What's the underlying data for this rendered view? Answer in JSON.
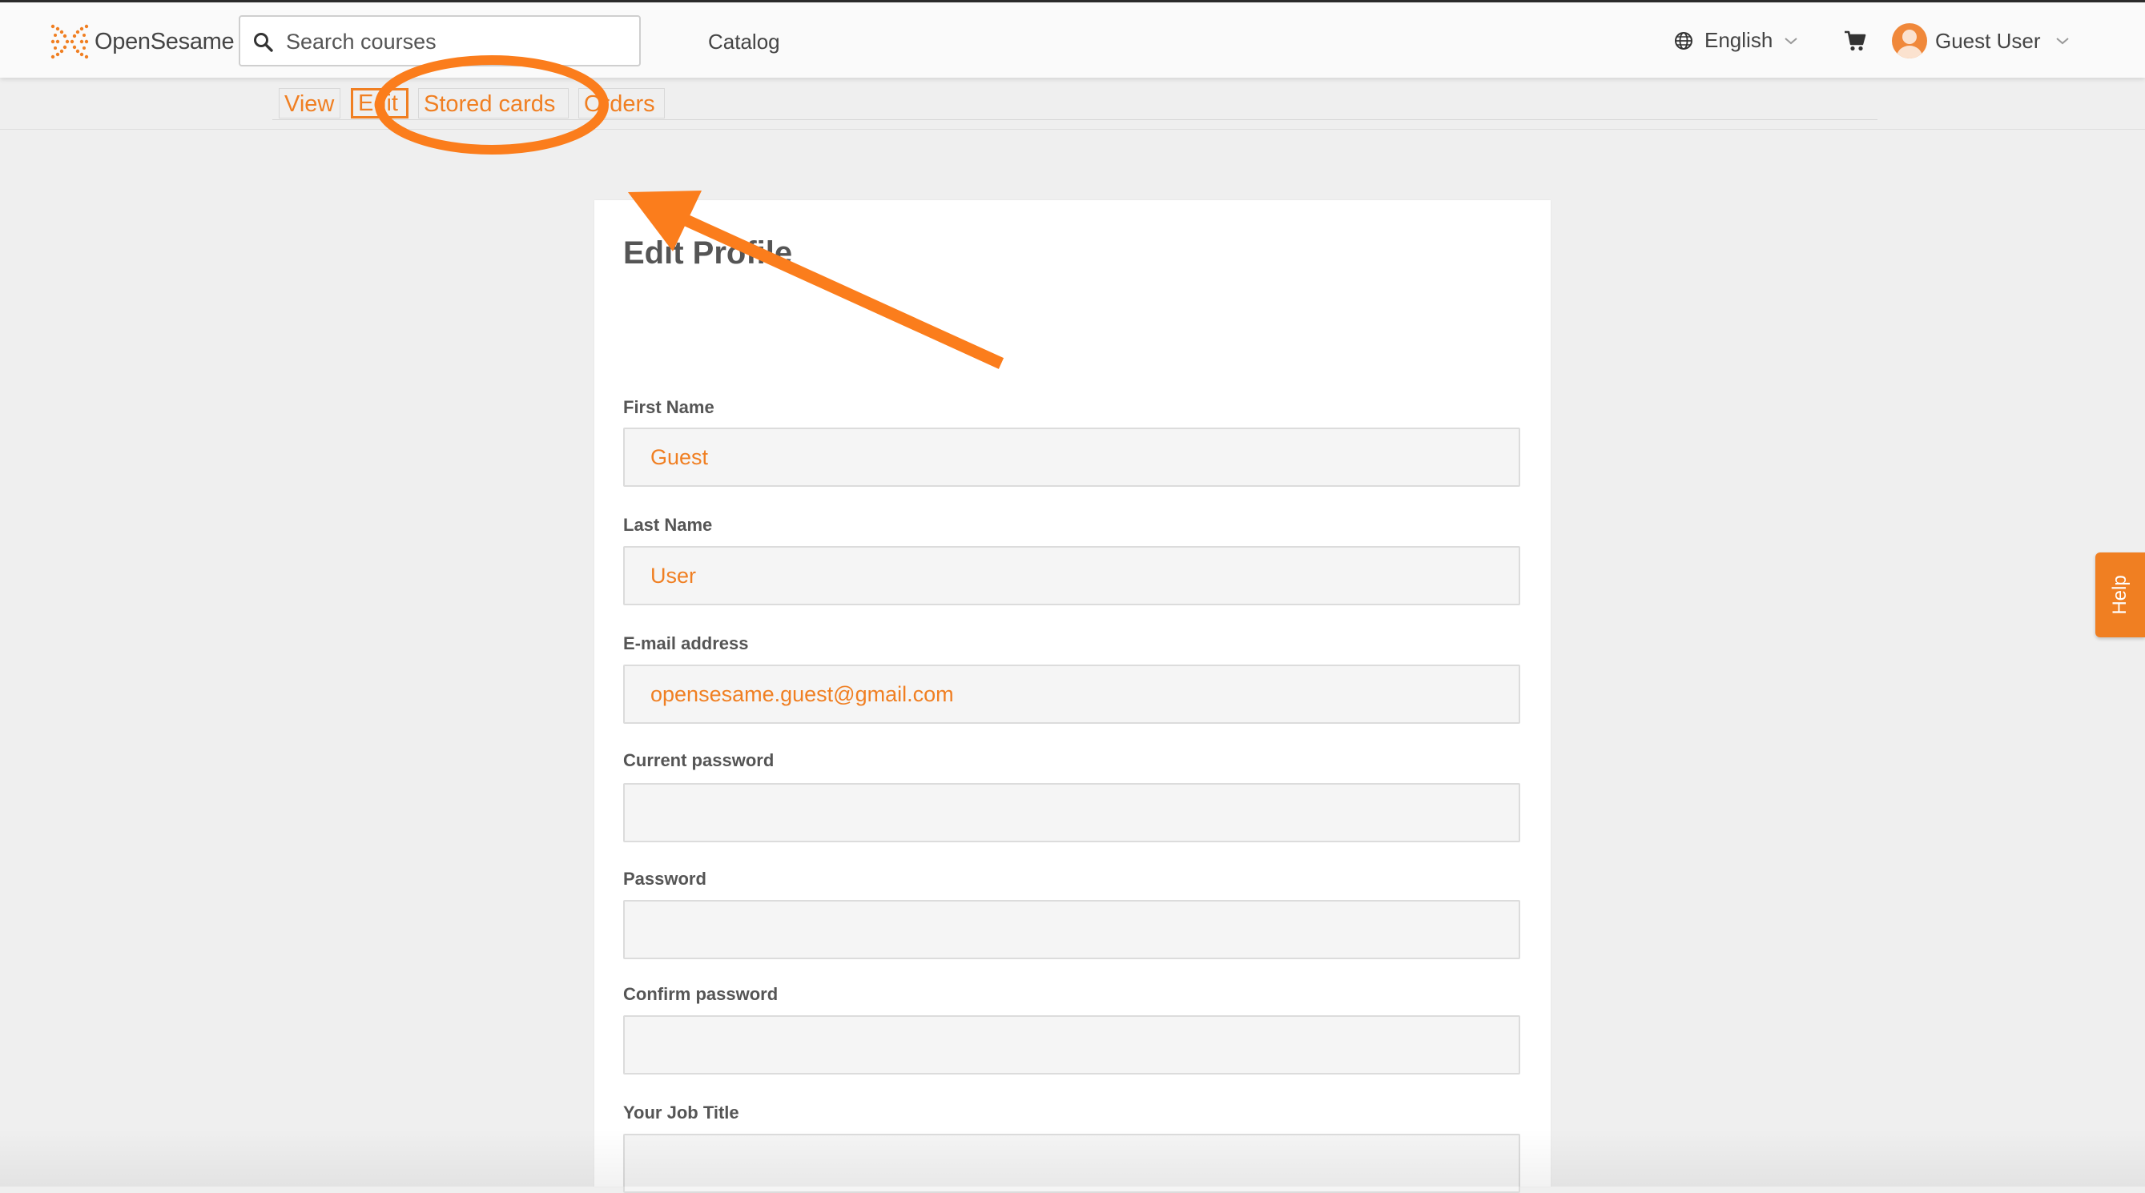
{
  "header": {
    "logo_text": "OpenSesame",
    "search_placeholder": "Search courses",
    "nav_catalog": "Catalog",
    "language": "English",
    "user_name": "Guest User"
  },
  "tabs": [
    {
      "label": "View",
      "active": false
    },
    {
      "label": "Edit",
      "active": true
    },
    {
      "label": "Stored cards",
      "active": false
    },
    {
      "label": "Orders",
      "active": false
    }
  ],
  "form": {
    "title": "Edit Profile",
    "fields": [
      {
        "label": "First Name",
        "value": ""
      },
      {
        "label": "Last Name",
        "value": ""
      },
      {
        "label": "E-mail address",
        "value": ""
      },
      {
        "label": "Current password",
        "value": ""
      },
      {
        "label": "Password",
        "value": ""
      },
      {
        "label": "Confirm password",
        "value": ""
      },
      {
        "label": "Your Job Title",
        "value": ""
      }
    ],
    "values": {
      "first_name": "Guest",
      "last_name": "User",
      "email": "opensesame.guest@gmail.com"
    }
  },
  "help_label": "Help",
  "colors": {
    "brand_orange": "#f07f22",
    "annotation_orange": "#fb7d1c",
    "page_background": "#efefef"
  },
  "icons": [
    "opensesame-logo-icon",
    "search-icon",
    "globe-icon",
    "chevron-down-icon",
    "cart-icon",
    "avatar-icon"
  ],
  "annotation": {
    "type": "ellipse-and-arrow",
    "target": "Stored cards"
  }
}
